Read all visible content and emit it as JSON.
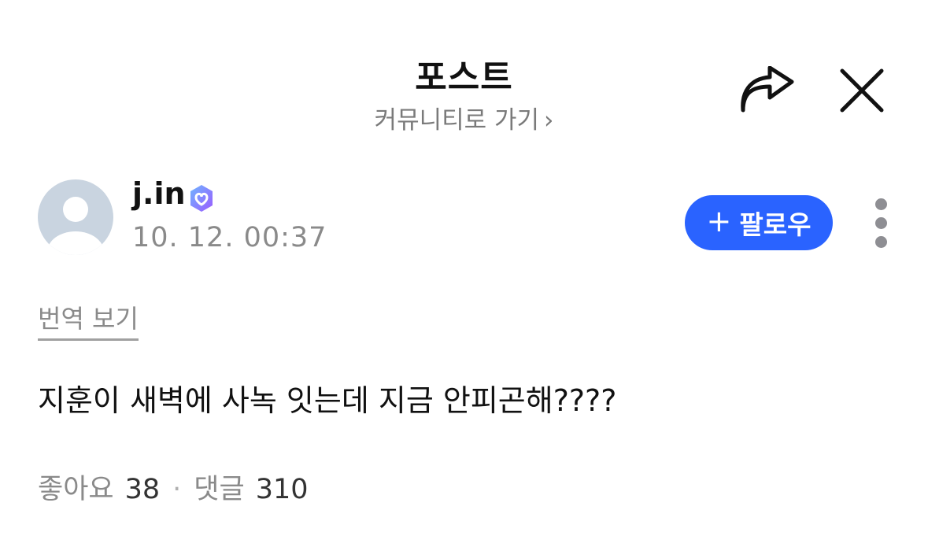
{
  "header": {
    "title": "포스트",
    "community_link": "커뮤니티로 가기",
    "community_chevron": "›",
    "share_icon": "share-arrow-icon",
    "close_icon": "close-icon"
  },
  "author": {
    "name": "j.in",
    "timestamp": "10. 12. 00:37",
    "verified_icon": "verified-badge-icon",
    "avatar_icon": "default-avatar-icon"
  },
  "follow": {
    "plus": "+",
    "label": "팔로우"
  },
  "more_icon": "more-vertical-icon",
  "translate_label": "번역 보기",
  "post": {
    "text": "지훈이 새벽에 사녹 잇는데 지금 안피곤해????"
  },
  "stats": {
    "likes_label": "좋아요",
    "likes_count": "38",
    "separator": "·",
    "comments_label": "댓글",
    "comments_count": "310"
  },
  "colors": {
    "accent": "#2a63ff",
    "muted_text": "#8a8a8a",
    "badge_gradient_start": "#6fb4ff",
    "badge_gradient_end": "#9b5cff"
  }
}
